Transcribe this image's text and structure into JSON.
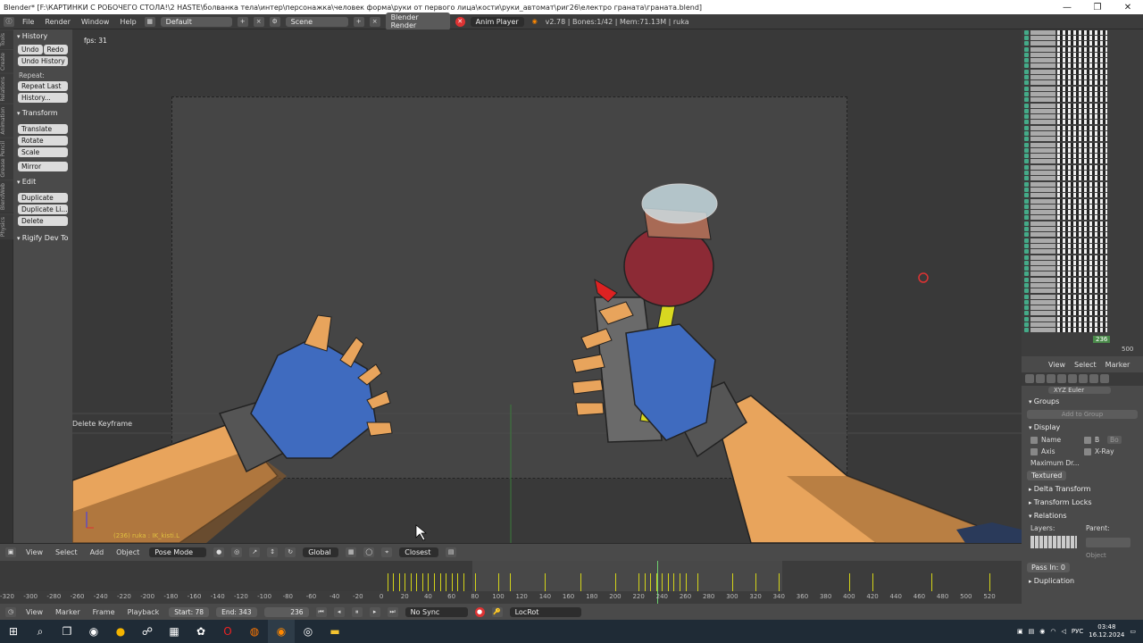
{
  "window": {
    "title": "Blender* [F:\\КАРТИНКИ С РОБОЧЕГО СТОЛА!\\2 HASTE\\болванка тела\\интер\\персонажка\\человек форма\\руки от первого лица\\кости\\руки_автомат\\риг26\\електро граната\\граната.blend]",
    "min": "—",
    "max": "❐",
    "close": "✕"
  },
  "infobar": {
    "menus": [
      "File",
      "Render",
      "Window",
      "Help"
    ],
    "layout": "Default",
    "scene": "Scene",
    "engine": "Blender Render",
    "anim_player": "Anim Player",
    "stats": "v2.78 | Bones:1/42 | Mem:71.13M | ruka"
  },
  "tool_tabs": [
    "Tools",
    "Create",
    "Relations",
    "Animation",
    "Grease Pencil",
    "BlendWeb",
    "Physics"
  ],
  "toolpanel": {
    "history_header": "History",
    "undo": "Undo",
    "redo": "Redo",
    "undo_history": "Undo History",
    "repeat_label": "Repeat:",
    "repeat_last": "Repeat Last",
    "history_btn": "History...",
    "transform_header": "Transform",
    "translate": "Translate",
    "rotate": "Rotate",
    "scale": "Scale",
    "mirror": "Mirror",
    "edit_header": "Edit",
    "duplicate": "Duplicate",
    "duplicate_linked": "Duplicate Li...",
    "delete": "Delete",
    "rigify_header": "Rigify Dev To",
    "delete_keyframe": "Delete Keyframe"
  },
  "viewport": {
    "fps": "fps: 31",
    "object_status": "(236) ruka : IK_kisti.L"
  },
  "dopesheet_header": {
    "view": "View",
    "select": "Select",
    "marker": "Marker"
  },
  "outliner": {
    "frame_badge": "236",
    "end_value": "500"
  },
  "props": {
    "rotation_mode": "XYZ Euler",
    "groups": "Groups",
    "add_to_group": "Add to Group",
    "display": "Display",
    "name_label": "Name",
    "b_label": "B",
    "bo_label": "Bo",
    "axis_label": "Axis",
    "xray_label": "X-Ray",
    "max_draw": "Maximum Dr...",
    "textured": "Textured",
    "delta_transform": "Delta Transform",
    "transform_locks": "Transform Locks",
    "relations": "Relations",
    "layers": "Layers:",
    "parent": "Parent:",
    "object_sel": "Object",
    "pass_index": "Pass In: 0",
    "duplication": "Duplication"
  },
  "viewport_header": {
    "view": "View",
    "select": "Select",
    "add": "Add",
    "object": "Object",
    "mode": "Pose Mode",
    "orientation": "Global",
    "snap": "Closest"
  },
  "timeline": {
    "ticks": [
      "-320",
      "-300",
      "-280",
      "-260",
      "-240",
      "-220",
      "-200",
      "-180",
      "-160",
      "-140",
      "-120",
      "-100",
      "-80",
      "-60",
      "-40",
      "-20",
      "0",
      "20",
      "40",
      "60",
      "80",
      "100",
      "120",
      "140",
      "160",
      "180",
      "200",
      "220",
      "240",
      "260",
      "280",
      "300",
      "320",
      "340",
      "360",
      "380",
      "400",
      "420",
      "440",
      "460",
      "480",
      "500",
      "520"
    ],
    "keyframes": [
      5,
      10,
      15,
      20,
      25,
      30,
      35,
      40,
      45,
      50,
      55,
      60,
      65,
      70,
      80,
      100,
      110,
      140,
      170,
      200,
      220,
      225,
      230,
      235,
      240,
      245,
      250,
      255,
      260,
      270,
      300,
      320,
      340,
      400,
      420,
      470,
      520
    ]
  },
  "timeline_header": {
    "view": "View",
    "marker": "Marker",
    "frame": "Frame",
    "playback": "Playback",
    "start_label": "Start:",
    "start": "78",
    "end_label": "End:",
    "end": "343",
    "current": "236",
    "sync": "No Sync",
    "keying_set": "LocRot"
  },
  "taskbar": {
    "lang": "РУС",
    "time": "03:48",
    "date": "16.12.2024"
  }
}
